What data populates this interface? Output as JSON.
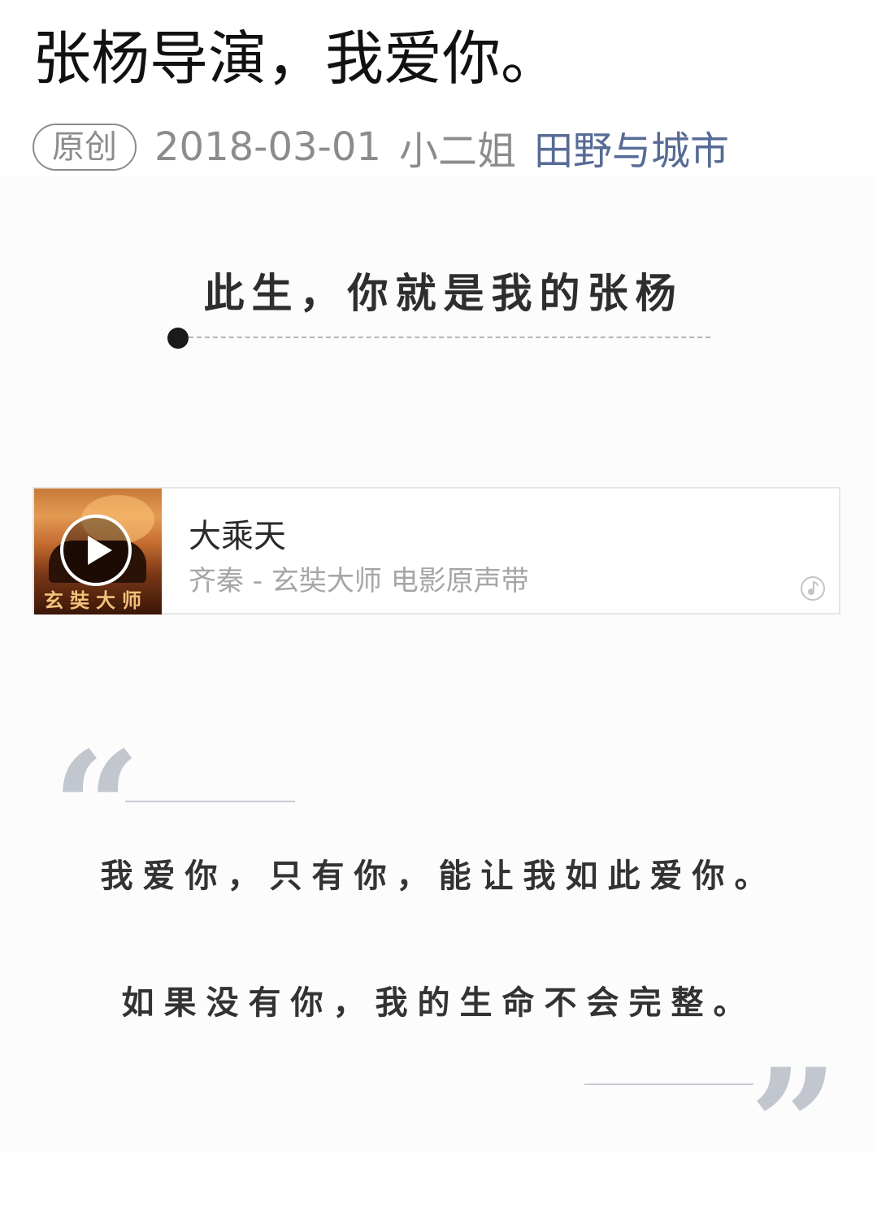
{
  "article": {
    "title": "张杨导演，我爱你。",
    "meta": {
      "badge": "原创",
      "date": "2018-03-01",
      "author": "小二姐",
      "account": "田野与城市"
    }
  },
  "section": {
    "heading": "此生，你就是我的张杨"
  },
  "music": {
    "title": "大乘天",
    "subtitle": "齐秦 - 玄奘大师 电影原声带",
    "cover_caption": "玄奘大师",
    "play_icon": "play-icon",
    "note_icon": "music-note-icon"
  },
  "quote": {
    "open_mark": "“",
    "lines": [
      "我爱你，只有你，能让我如此爱你。",
      "如果没有你，我的生命不会完整。"
    ],
    "close_mark": "”"
  },
  "colors": {
    "link": "#576b95",
    "meta_gray": "#8c8c8c",
    "quote_mark": "#c2c6cf",
    "section_bg": "#fcfcfd"
  }
}
